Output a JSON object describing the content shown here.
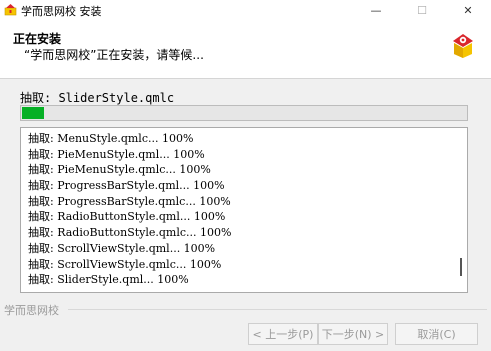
{
  "window": {
    "title": "学而思网校 安装",
    "min_glyph": "—",
    "max_glyph": "☐",
    "close_glyph": "✕"
  },
  "header": {
    "title": "正在安装",
    "subtitle": "“学而思网校”正在安装，请等候..."
  },
  "status": {
    "current": "抽取: SliderStyle.qmlc",
    "progress": 0.05
  },
  "log": {
    "lines": [
      "抽取: MenuStyle.qmlc... 100%",
      "抽取: PieMenuStyle.qml... 100%",
      "抽取: PieMenuStyle.qmlc... 100%",
      "抽取: ProgressBarStyle.qml... 100%",
      "抽取: ProgressBarStyle.qmlc... 100%",
      "抽取: RadioButtonStyle.qml... 100%",
      "抽取: RadioButtonStyle.qmlc... 100%",
      "抽取: ScrollViewStyle.qml... 100%",
      "抽取: ScrollViewStyle.qmlc... 100%",
      "抽取: SliderStyle.qml... 100%"
    ]
  },
  "footer": {
    "brand": "学而思网校",
    "back_label": "< 上一步(P)",
    "next_label": "下一步(N) >",
    "cancel_label": "取消(C)"
  },
  "colors": {
    "progress": "#06b025",
    "logo_red": "#d9262c",
    "logo_yellow": "#f5c400"
  }
}
